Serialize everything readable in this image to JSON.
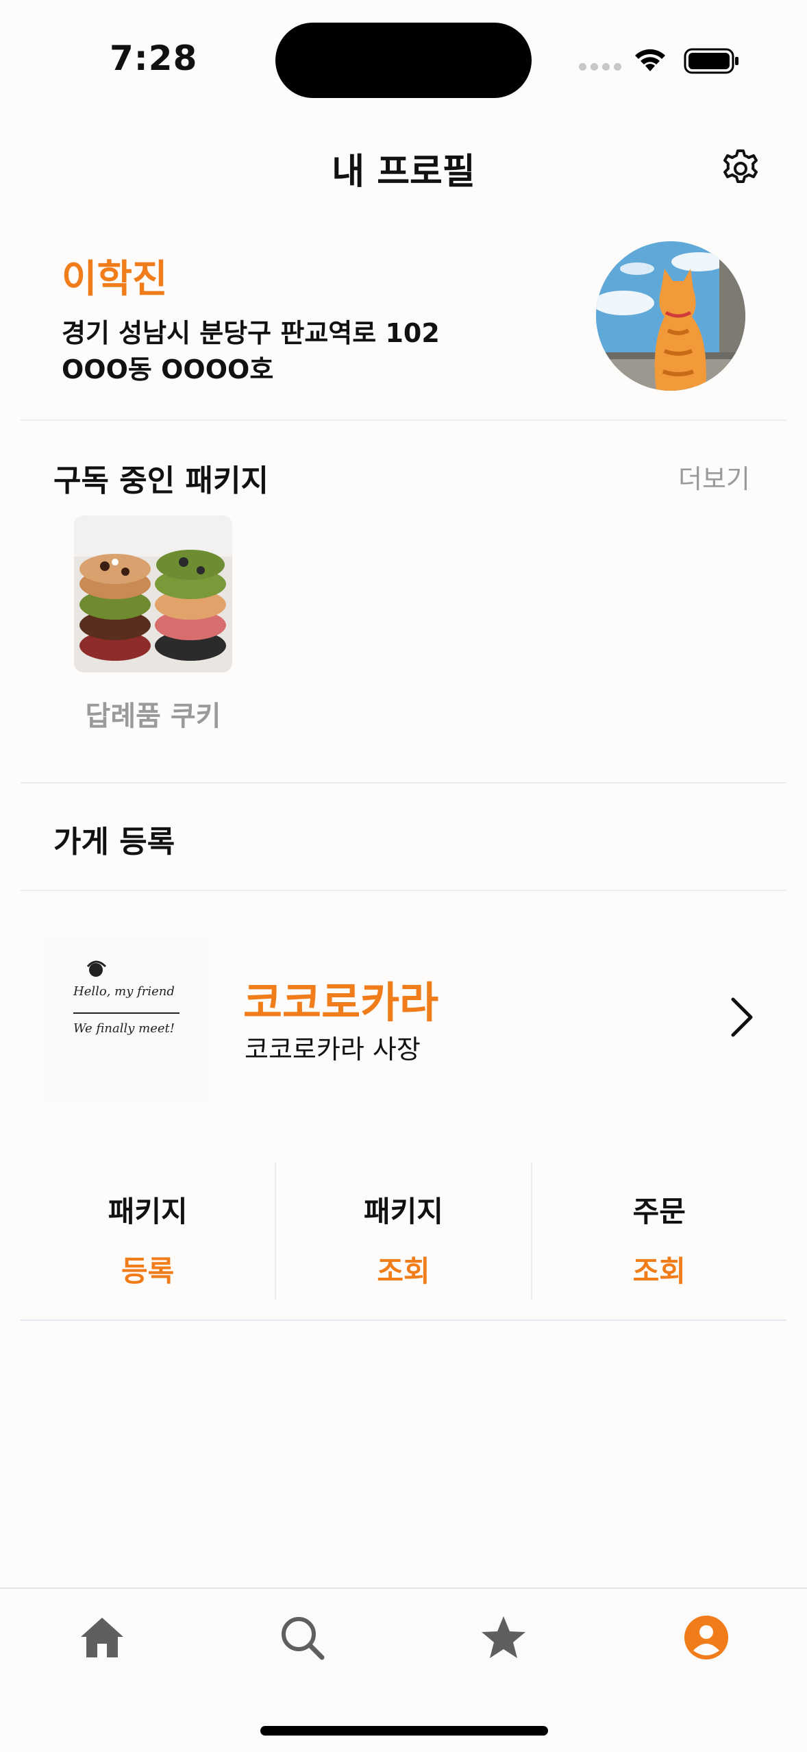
{
  "status_bar": {
    "time": "7:28"
  },
  "header": {
    "title": "내 프로필",
    "settings_icon": "gear-icon"
  },
  "profile": {
    "name": "이학진",
    "address_line1": "경기 성남시 분당구 판교역로 102",
    "address_line2": "OOO동 OOOO호"
  },
  "subscribed": {
    "title": "구독 중인 패키지",
    "more_label": "더보기",
    "items": [
      {
        "label": "답례품 쿠키"
      }
    ]
  },
  "store_section": {
    "title": "가게 등록"
  },
  "store": {
    "logo_text_line1": "Hello, my friend",
    "logo_text_line2": "We finally meet!",
    "name": "코코로카라",
    "subtitle": "코코로카라 사장"
  },
  "actions": [
    {
      "top": "패키지",
      "bottom": "등록"
    },
    {
      "top": "패키지",
      "bottom": "조회"
    },
    {
      "top": "주문",
      "bottom": "조회"
    }
  ],
  "tabbar": {
    "tabs": [
      {
        "icon": "home-icon",
        "active": false
      },
      {
        "icon": "search-icon",
        "active": false
      },
      {
        "icon": "star-icon",
        "active": false
      },
      {
        "icon": "profile-icon",
        "active": true
      }
    ]
  },
  "colors": {
    "accent": "#f07c1a",
    "inactive_tab": "#5f5f5f",
    "muted": "#9a9a9a"
  }
}
